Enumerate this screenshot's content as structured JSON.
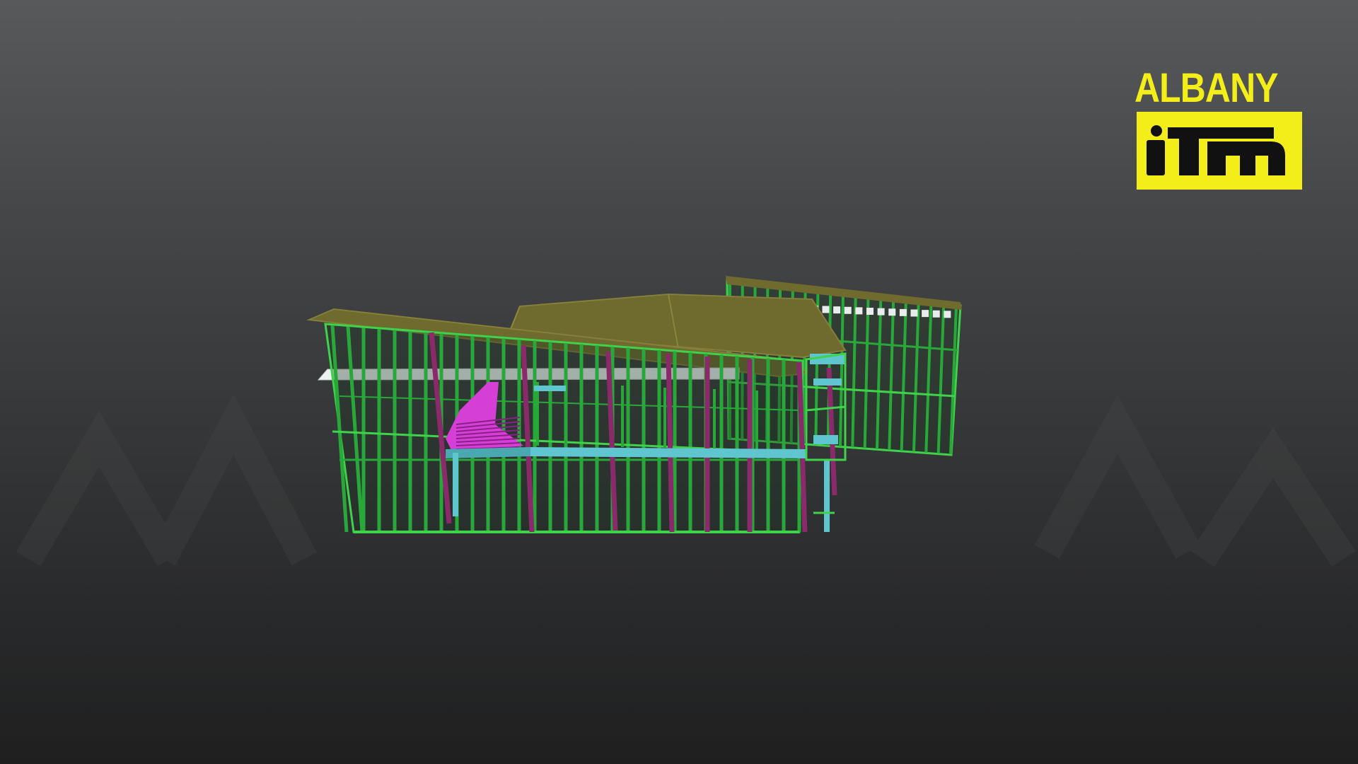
{
  "viewer": {
    "background_top": "#58595b",
    "background_bottom": "#1f1f20",
    "content": "3d-building-frame-model"
  },
  "logo": {
    "text": "ALBANY",
    "mark_text": "itm",
    "color": "#f3ee1a"
  },
  "model_colors": {
    "frame": "#29a83a",
    "frame_edge": "#3fd24a",
    "roof": "#6f6a2e",
    "beam": "#8a2a6a",
    "brace": "#d63fd6",
    "steel": "#5fc6cf",
    "flashing": "#e8ecec"
  }
}
